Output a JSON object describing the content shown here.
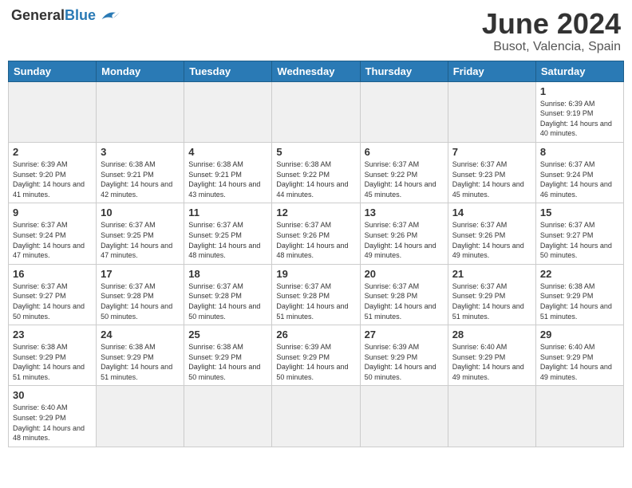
{
  "header": {
    "logo_general": "General",
    "logo_blue": "Blue",
    "month_title": "June 2024",
    "location": "Busot, Valencia, Spain"
  },
  "weekdays": [
    "Sunday",
    "Monday",
    "Tuesday",
    "Wednesday",
    "Thursday",
    "Friday",
    "Saturday"
  ],
  "days": [
    {
      "num": "",
      "empty": true
    },
    {
      "num": "",
      "empty": true
    },
    {
      "num": "",
      "empty": true
    },
    {
      "num": "",
      "empty": true
    },
    {
      "num": "",
      "empty": true
    },
    {
      "num": "",
      "empty": true
    },
    {
      "num": "1",
      "sunrise": "Sunrise: 6:39 AM",
      "sunset": "Sunset: 9:19 PM",
      "daylight": "Daylight: 14 hours and 40 minutes."
    },
    {
      "num": "2",
      "sunrise": "Sunrise: 6:39 AM",
      "sunset": "Sunset: 9:20 PM",
      "daylight": "Daylight: 14 hours and 41 minutes."
    },
    {
      "num": "3",
      "sunrise": "Sunrise: 6:38 AM",
      "sunset": "Sunset: 9:21 PM",
      "daylight": "Daylight: 14 hours and 42 minutes."
    },
    {
      "num": "4",
      "sunrise": "Sunrise: 6:38 AM",
      "sunset": "Sunset: 9:21 PM",
      "daylight": "Daylight: 14 hours and 43 minutes."
    },
    {
      "num": "5",
      "sunrise": "Sunrise: 6:38 AM",
      "sunset": "Sunset: 9:22 PM",
      "daylight": "Daylight: 14 hours and 44 minutes."
    },
    {
      "num": "6",
      "sunrise": "Sunrise: 6:37 AM",
      "sunset": "Sunset: 9:22 PM",
      "daylight": "Daylight: 14 hours and 45 minutes."
    },
    {
      "num": "7",
      "sunrise": "Sunrise: 6:37 AM",
      "sunset": "Sunset: 9:23 PM",
      "daylight": "Daylight: 14 hours and 45 minutes."
    },
    {
      "num": "8",
      "sunrise": "Sunrise: 6:37 AM",
      "sunset": "Sunset: 9:24 PM",
      "daylight": "Daylight: 14 hours and 46 minutes."
    },
    {
      "num": "9",
      "sunrise": "Sunrise: 6:37 AM",
      "sunset": "Sunset: 9:24 PM",
      "daylight": "Daylight: 14 hours and 47 minutes."
    },
    {
      "num": "10",
      "sunrise": "Sunrise: 6:37 AM",
      "sunset": "Sunset: 9:25 PM",
      "daylight": "Daylight: 14 hours and 47 minutes."
    },
    {
      "num": "11",
      "sunrise": "Sunrise: 6:37 AM",
      "sunset": "Sunset: 9:25 PM",
      "daylight": "Daylight: 14 hours and 48 minutes."
    },
    {
      "num": "12",
      "sunrise": "Sunrise: 6:37 AM",
      "sunset": "Sunset: 9:26 PM",
      "daylight": "Daylight: 14 hours and 48 minutes."
    },
    {
      "num": "13",
      "sunrise": "Sunrise: 6:37 AM",
      "sunset": "Sunset: 9:26 PM",
      "daylight": "Daylight: 14 hours and 49 minutes."
    },
    {
      "num": "14",
      "sunrise": "Sunrise: 6:37 AM",
      "sunset": "Sunset: 9:26 PM",
      "daylight": "Daylight: 14 hours and 49 minutes."
    },
    {
      "num": "15",
      "sunrise": "Sunrise: 6:37 AM",
      "sunset": "Sunset: 9:27 PM",
      "daylight": "Daylight: 14 hours and 50 minutes."
    },
    {
      "num": "16",
      "sunrise": "Sunrise: 6:37 AM",
      "sunset": "Sunset: 9:27 PM",
      "daylight": "Daylight: 14 hours and 50 minutes."
    },
    {
      "num": "17",
      "sunrise": "Sunrise: 6:37 AM",
      "sunset": "Sunset: 9:28 PM",
      "daylight": "Daylight: 14 hours and 50 minutes."
    },
    {
      "num": "18",
      "sunrise": "Sunrise: 6:37 AM",
      "sunset": "Sunset: 9:28 PM",
      "daylight": "Daylight: 14 hours and 50 minutes."
    },
    {
      "num": "19",
      "sunrise": "Sunrise: 6:37 AM",
      "sunset": "Sunset: 9:28 PM",
      "daylight": "Daylight: 14 hours and 51 minutes."
    },
    {
      "num": "20",
      "sunrise": "Sunrise: 6:37 AM",
      "sunset": "Sunset: 9:28 PM",
      "daylight": "Daylight: 14 hours and 51 minutes."
    },
    {
      "num": "21",
      "sunrise": "Sunrise: 6:37 AM",
      "sunset": "Sunset: 9:29 PM",
      "daylight": "Daylight: 14 hours and 51 minutes."
    },
    {
      "num": "22",
      "sunrise": "Sunrise: 6:38 AM",
      "sunset": "Sunset: 9:29 PM",
      "daylight": "Daylight: 14 hours and 51 minutes."
    },
    {
      "num": "23",
      "sunrise": "Sunrise: 6:38 AM",
      "sunset": "Sunset: 9:29 PM",
      "daylight": "Daylight: 14 hours and 51 minutes."
    },
    {
      "num": "24",
      "sunrise": "Sunrise: 6:38 AM",
      "sunset": "Sunset: 9:29 PM",
      "daylight": "Daylight: 14 hours and 51 minutes."
    },
    {
      "num": "25",
      "sunrise": "Sunrise: 6:38 AM",
      "sunset": "Sunset: 9:29 PM",
      "daylight": "Daylight: 14 hours and 50 minutes."
    },
    {
      "num": "26",
      "sunrise": "Sunrise: 6:39 AM",
      "sunset": "Sunset: 9:29 PM",
      "daylight": "Daylight: 14 hours and 50 minutes."
    },
    {
      "num": "27",
      "sunrise": "Sunrise: 6:39 AM",
      "sunset": "Sunset: 9:29 PM",
      "daylight": "Daylight: 14 hours and 50 minutes."
    },
    {
      "num": "28",
      "sunrise": "Sunrise: 6:40 AM",
      "sunset": "Sunset: 9:29 PM",
      "daylight": "Daylight: 14 hours and 49 minutes."
    },
    {
      "num": "29",
      "sunrise": "Sunrise: 6:40 AM",
      "sunset": "Sunset: 9:29 PM",
      "daylight": "Daylight: 14 hours and 49 minutes."
    },
    {
      "num": "30",
      "sunrise": "Sunrise: 6:40 AM",
      "sunset": "Sunset: 9:29 PM",
      "daylight": "Daylight: 14 hours and 48 minutes."
    }
  ]
}
